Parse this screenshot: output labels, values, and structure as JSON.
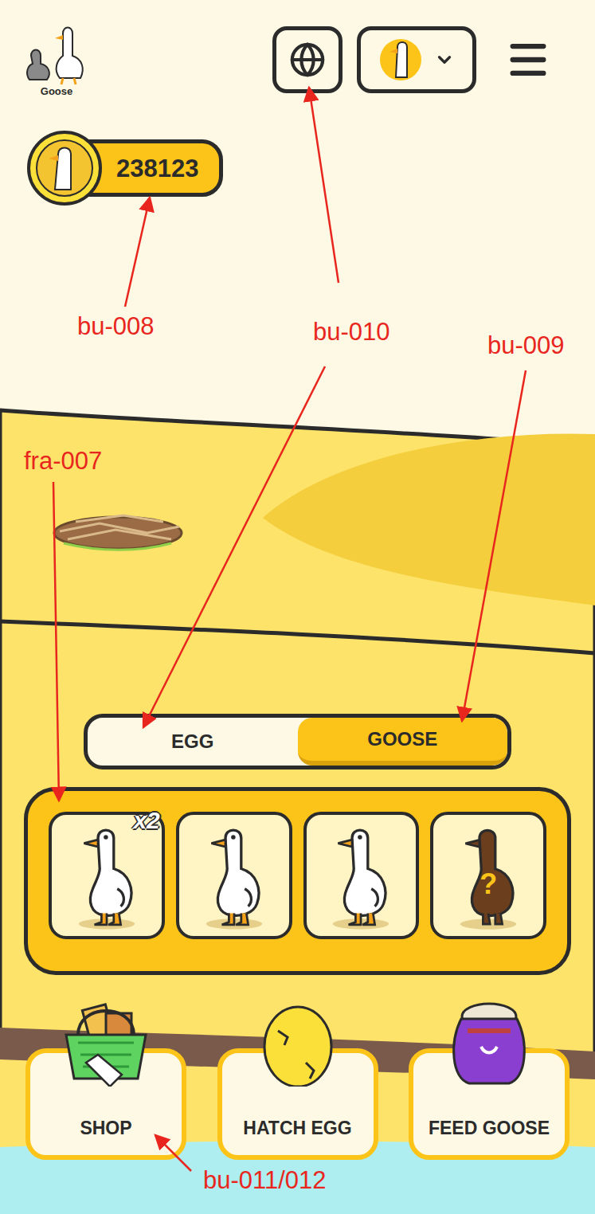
{
  "logo": {
    "label": "Goose"
  },
  "balance": {
    "amount": "238123"
  },
  "tabs": [
    {
      "label": "EGG",
      "selected": false
    },
    {
      "label": "GOOSE",
      "selected": true
    }
  ],
  "geese": [
    {
      "kind": "goose",
      "badge": "x2"
    },
    {
      "kind": "goose"
    },
    {
      "kind": "goose"
    },
    {
      "kind": "locked",
      "mark": "?"
    }
  ],
  "actions": [
    {
      "label": "SHOP",
      "kind": "shop"
    },
    {
      "label": "HATCH EGG",
      "kind": "egg"
    },
    {
      "label": "FEED GOOSE",
      "kind": "feed"
    }
  ],
  "annotations": [
    {
      "label": "bu-008"
    },
    {
      "label": "bu-010"
    },
    {
      "label": "bu-009"
    },
    {
      "label": "fra-007"
    },
    {
      "label": "bu-011/012"
    }
  ]
}
